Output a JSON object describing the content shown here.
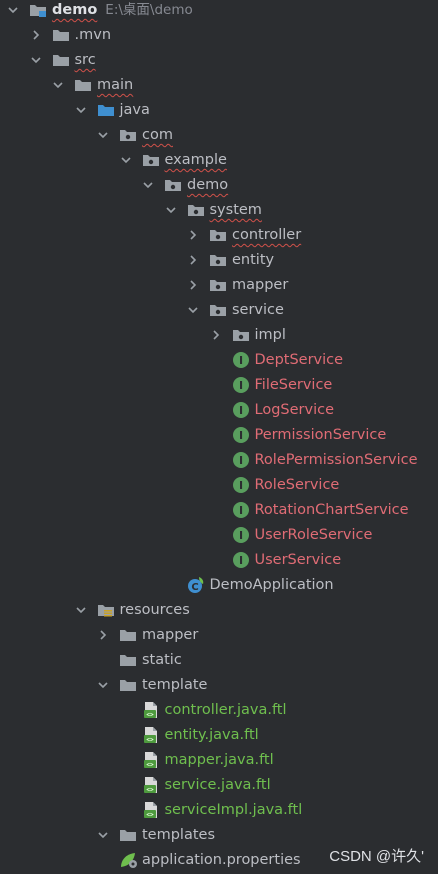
{
  "tree": [
    {
      "label": "demo",
      "hint": "E:\\桌面\\demo",
      "depth": 0,
      "icon": "module-folder-icon",
      "chevron": "down",
      "style": "bold-wavy"
    },
    {
      "label": ".mvn",
      "depth": 1,
      "icon": "folder-icon",
      "chevron": "right"
    },
    {
      "label": "src",
      "depth": 1,
      "icon": "folder-icon",
      "chevron": "down",
      "style": "wavy"
    },
    {
      "label": "main",
      "depth": 2,
      "icon": "folder-icon",
      "chevron": "down",
      "style": "wavy"
    },
    {
      "label": "java",
      "depth": 3,
      "icon": "source-root-icon",
      "chevron": "down"
    },
    {
      "label": "com",
      "depth": 4,
      "icon": "package-icon",
      "chevron": "down",
      "style": "wavy"
    },
    {
      "label": "example",
      "depth": 5,
      "icon": "package-icon",
      "chevron": "down",
      "style": "wavy"
    },
    {
      "label": "demo",
      "depth": 6,
      "icon": "package-icon",
      "chevron": "down",
      "style": "wavy"
    },
    {
      "label": "system",
      "depth": 7,
      "icon": "package-icon",
      "chevron": "down",
      "style": "wavy"
    },
    {
      "label": "controller",
      "depth": 8,
      "icon": "package-icon",
      "chevron": "right",
      "style": "wavy"
    },
    {
      "label": "entity",
      "depth": 8,
      "icon": "package-icon",
      "chevron": "right"
    },
    {
      "label": "mapper",
      "depth": 8,
      "icon": "package-icon",
      "chevron": "right"
    },
    {
      "label": "service",
      "depth": 8,
      "icon": "package-icon",
      "chevron": "down"
    },
    {
      "label": "impl",
      "depth": 9,
      "icon": "package-icon",
      "chevron": "right"
    },
    {
      "label": "DeptService",
      "depth": 9,
      "icon": "interface-icon",
      "style": "red"
    },
    {
      "label": "FileService",
      "depth": 9,
      "icon": "interface-icon",
      "style": "red"
    },
    {
      "label": "LogService",
      "depth": 9,
      "icon": "interface-icon",
      "style": "red"
    },
    {
      "label": "PermissionService",
      "depth": 9,
      "icon": "interface-icon",
      "style": "red"
    },
    {
      "label": "RolePermissionService",
      "depth": 9,
      "icon": "interface-icon",
      "style": "red"
    },
    {
      "label": "RoleService",
      "depth": 9,
      "icon": "interface-icon",
      "style": "red"
    },
    {
      "label": "RotationChartService",
      "depth": 9,
      "icon": "interface-icon",
      "style": "red"
    },
    {
      "label": "UserRoleService",
      "depth": 9,
      "icon": "interface-icon",
      "style": "red"
    },
    {
      "label": "UserService",
      "depth": 9,
      "icon": "interface-icon",
      "style": "red"
    },
    {
      "label": "DemoApplication",
      "depth": 7,
      "icon": "spring-boot-class-icon"
    },
    {
      "label": "resources",
      "depth": 3,
      "icon": "resources-root-icon",
      "chevron": "down"
    },
    {
      "label": "mapper",
      "depth": 4,
      "icon": "folder-icon",
      "chevron": "right"
    },
    {
      "label": "static",
      "depth": 4,
      "icon": "folder-icon"
    },
    {
      "label": "template",
      "depth": 4,
      "icon": "folder-icon",
      "chevron": "down"
    },
    {
      "label": "controller.java.ftl",
      "depth": 5,
      "icon": "ftl-file-icon",
      "style": "green"
    },
    {
      "label": "entity.java.ftl",
      "depth": 5,
      "icon": "ftl-file-icon",
      "style": "green"
    },
    {
      "label": "mapper.java.ftl",
      "depth": 5,
      "icon": "ftl-file-icon",
      "style": "green"
    },
    {
      "label": "service.java.ftl",
      "depth": 5,
      "icon": "ftl-file-icon",
      "style": "green"
    },
    {
      "label": "serviceImpl.java.ftl",
      "depth": 5,
      "icon": "ftl-file-icon",
      "style": "green"
    },
    {
      "label": "templates",
      "depth": 4,
      "icon": "folder-icon",
      "chevron": "down"
    },
    {
      "label": "application.properties",
      "depth": 4,
      "icon": "spring-properties-icon"
    }
  ],
  "watermark": "CSDN @许久'",
  "colors": {
    "background": "#2b2d30",
    "text": "#bcbec4",
    "untracked_red": "#e06c75",
    "added_green": "#6fbf4e",
    "folder": "#9aa0a6",
    "source_root": "#3f8fd0",
    "interface_badge": "#599e5e"
  }
}
